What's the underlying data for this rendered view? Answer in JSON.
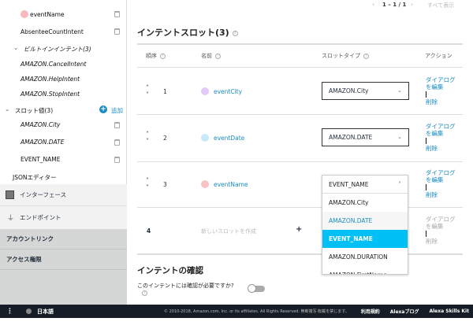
{
  "sidebar": {
    "items": [
      {
        "label": "eventName",
        "color": "#f7b9bd"
      },
      {
        "label": "AbsenteeCountIntent"
      },
      {
        "label": "ビルトインインテント(3)"
      },
      {
        "label": "AMAZON.CancelIntent"
      },
      {
        "label": "AMAZON.HelpIntent"
      },
      {
        "label": "AMAZON.StopIntent"
      },
      {
        "label": "スロット値(3)"
      },
      {
        "label": "AMAZON.City"
      },
      {
        "label": "AMAZON.DATE"
      },
      {
        "label": "EVENT_NAME"
      },
      {
        "label": "JSONエディター"
      }
    ],
    "add_label": "追加",
    "interface": "インターフェース",
    "endpoint": "エンドポイント",
    "account_link": "アカウントリンク",
    "access": "アクセス権限"
  },
  "pager": {
    "range": "1 – 1 / 1",
    "show_all": "すべて表示"
  },
  "slots": {
    "title": "インテントスロット(3)",
    "headers": {
      "order": "順序",
      "name": "名前",
      "type": "スロットタイプ",
      "action": "アクション"
    },
    "rows": [
      {
        "num": "1",
        "name": "eventCity",
        "color": "#e2c9f7",
        "type": "AMAZON.City"
      },
      {
        "num": "2",
        "name": "eventDate",
        "color": "#c9e9fb",
        "type": "AMAZON.DATE"
      },
      {
        "num": "3",
        "name": "eventName",
        "color": "#f7c2c4",
        "type": "EVENT_NAME"
      }
    ],
    "new_row": {
      "num": "4",
      "placeholder": "新しいスロットを作成",
      "plus": "+"
    },
    "edit_dialog": "ダイアログを編集",
    "delete": "削除",
    "dropdown_options": [
      "AMAZON.City",
      "AMAZON.DATE",
      "EVENT_NAME",
      "AMAZON.DURATION",
      "AMAZON.FirstName"
    ],
    "dropdown_selected": "EVENT_NAME",
    "dropdown_hover": "AMAZON.DATE"
  },
  "confirm": {
    "title": "インテントの確認",
    "question": "このインテントには確認が必要ですか?",
    "toggle_on": false
  },
  "footer": {
    "language": "日本語",
    "copyright": "© 2010-2018, Amazon.com, Inc. or its affiliates. All Rights Reserved. 無断複写·転載を禁じます。",
    "terms": "利用規約",
    "blog": "Alexaブログ",
    "skills_kit": "Alexa Skills Kit"
  },
  "colors": {
    "accent": "#1a8cc2",
    "selected": "#00c0f5",
    "footer": "#161d26"
  }
}
